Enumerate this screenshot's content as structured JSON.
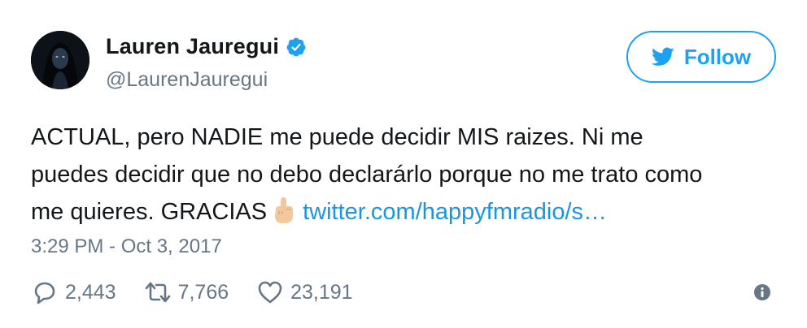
{
  "profile": {
    "display_name": "Lauren Jauregui",
    "handle": "@LaurenJauregui",
    "verified": true,
    "avatar_icon": "profile-photo"
  },
  "follow_button": {
    "label": "Follow",
    "icon": "twitter-bird-icon"
  },
  "tweet": {
    "lines": [
      "ACTUAL, pero NADIE me puede decidir MIS raizes. Ni me",
      "puedes decidir que no debo declarárlo porque no me trato como",
      "me quieres. GRACIAS"
    ],
    "emoji": "middle-finger-emoji",
    "link_text": "twitter.com/happyfmradio/s…"
  },
  "timestamp": "3:29 PM - Oct 3, 2017",
  "actions": {
    "replies": "2,443",
    "retweets": "7,766",
    "likes": "23,191"
  },
  "colors": {
    "accent": "#1da1f2",
    "link": "#1b95e0",
    "muted": "#657786",
    "text": "#14171a"
  }
}
